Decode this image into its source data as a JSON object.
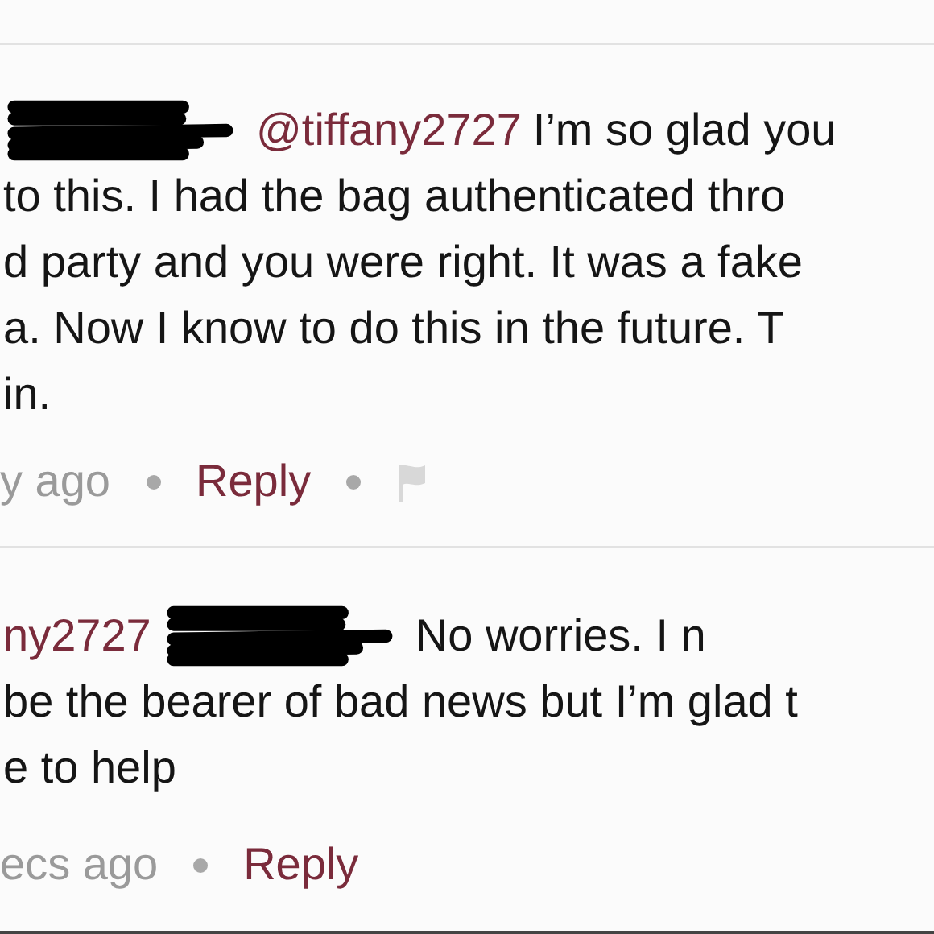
{
  "comments": [
    {
      "lines": [
        [
          {
            "kind": "redaction"
          },
          {
            "kind": "mention",
            "text": "@tiffany2727"
          },
          {
            "kind": "text",
            "text": "I’m so glad you"
          }
        ],
        [
          {
            "kind": "text",
            "text": "to this. I had the bag authenticated thro"
          }
        ],
        [
          {
            "kind": "text",
            "text": "d party and you were right. It was a fake"
          }
        ],
        [
          {
            "kind": "text",
            "text": "a. Now I know to do this in the future. T"
          }
        ],
        [
          {
            "kind": "text",
            "text": "in."
          }
        ]
      ],
      "time": "y ago",
      "reply": "Reply",
      "flag": true
    },
    {
      "lines": [
        [
          {
            "kind": "mention",
            "text": "ny2727"
          },
          {
            "kind": "redaction"
          },
          {
            "kind": "text",
            "text": "No worries. I n"
          }
        ],
        [
          {
            "kind": "text",
            "text": "be the bearer of bad news but I’m glad t"
          }
        ],
        [
          {
            "kind": "text",
            "text": "e to help"
          }
        ]
      ],
      "time": "ecs ago",
      "reply": "Reply",
      "flag": false
    }
  ]
}
